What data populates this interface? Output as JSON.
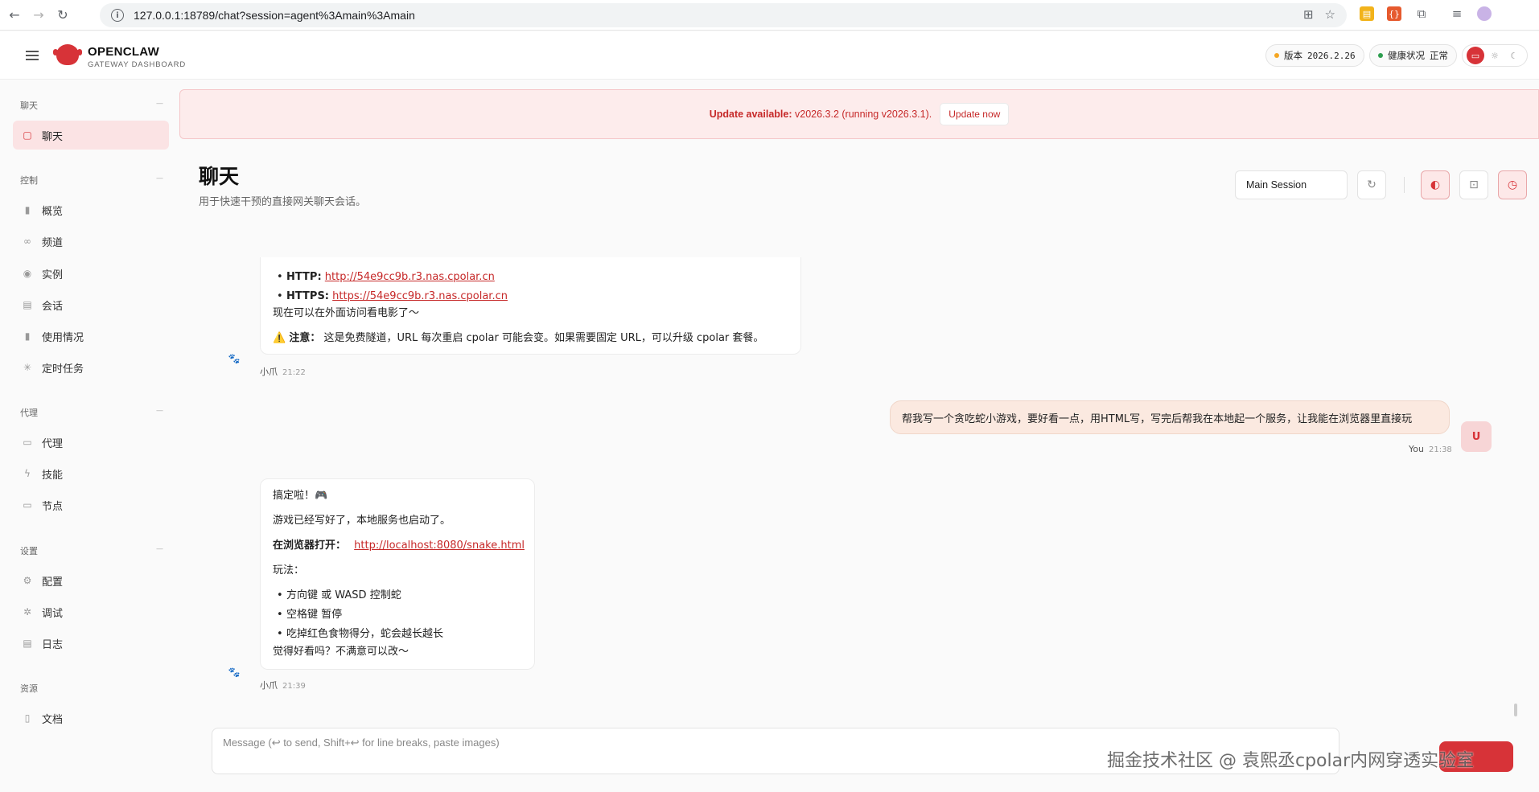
{
  "browser": {
    "url": "127.0.0.1:18789/chat?session=agent%3Amain%3Amain",
    "info_glyph": "i"
  },
  "header": {
    "brand_title": "OPENCLAW",
    "brand_sub": "GATEWAY DASHBOARD",
    "version_label": "版本",
    "version_value": "2026.2.26",
    "health_label": "健康状况",
    "health_value": "正常",
    "colors": {
      "accent": "#d73338",
      "version_dot": "#f5a623",
      "health_dot": "#2e9e4f"
    }
  },
  "sidebar": {
    "sections": [
      {
        "title": "聊天",
        "items": [
          {
            "label": "聊天",
            "icon": "message-icon",
            "active": true
          }
        ]
      },
      {
        "title": "控制",
        "items": [
          {
            "label": "概览",
            "icon": "bar-chart-icon"
          },
          {
            "label": "频道",
            "icon": "link-icon"
          },
          {
            "label": "实例",
            "icon": "broadcast-icon"
          },
          {
            "label": "会话",
            "icon": "document-icon"
          },
          {
            "label": "使用情况",
            "icon": "bar-chart-icon"
          },
          {
            "label": "定时任务",
            "icon": "loader-icon"
          }
        ]
      },
      {
        "title": "代理",
        "items": [
          {
            "label": "代理",
            "icon": "folder-icon"
          },
          {
            "label": "技能",
            "icon": "bolt-icon"
          },
          {
            "label": "节点",
            "icon": "monitor-icon"
          }
        ]
      },
      {
        "title": "设置",
        "items": [
          {
            "label": "配置",
            "icon": "gear-icon"
          },
          {
            "label": "调试",
            "icon": "bug-icon"
          },
          {
            "label": "日志",
            "icon": "log-icon"
          }
        ]
      },
      {
        "title": "资源",
        "items": [
          {
            "label": "文档",
            "icon": "book-icon"
          }
        ]
      }
    ]
  },
  "banner": {
    "prefix": "Update available:",
    "message": " v2026.3.2 (running v2026.3.1).",
    "button": "Update now"
  },
  "page": {
    "title": "聊天",
    "subtitle": "用于快速干预的直接网关聊天会话。",
    "session": "Main Session"
  },
  "messages": {
    "m1": {
      "http_label": "HTTP:",
      "http_url": "http://54e9cc9b.r3.nas.cpolar.cn",
      "https_label": "HTTPS:",
      "https_url": "https://54e9cc9b.r3.nas.cpolar.cn",
      "line1": "现在可以在外面访问看电影了～",
      "warn_label": "注意：",
      "warn_text": "这是免费隧道，URL 每次重启 cpolar 可能会变。如果需要固定 URL，可以升级 cpolar 套餐。",
      "sender": "小爪",
      "time": "21:22"
    },
    "user": {
      "text": "帮我写一个贪吃蛇小游戏，要好看一点，用HTML写，写完后帮我在本地起一个服务，让我能在浏览器里直接玩",
      "sender": "You",
      "time": "21:38",
      "avatar": "U"
    },
    "m2": {
      "line1": "搞定啦！🎮",
      "line2": "游戏已经写好了，本地服务也启动了。",
      "open_label": "在浏览器打开：",
      "open_url": "http://localhost:8080/snake.html",
      "howto": "玩法：",
      "b1": "方向键 或 WASD 控制蛇",
      "b2": "空格键 暂停",
      "b3": "吃掉红色食物得分，蛇会越长越长",
      "closing": "觉得好看吗？不满意可以改～",
      "sender": "小爪",
      "time": "21:39"
    }
  },
  "composer": {
    "placeholder": "Message (↩ to send, Shift+↩ for line breaks, paste images)"
  },
  "watermark": "掘金技术社区 @ 袁熙丞cpolar内网穿透实验室"
}
